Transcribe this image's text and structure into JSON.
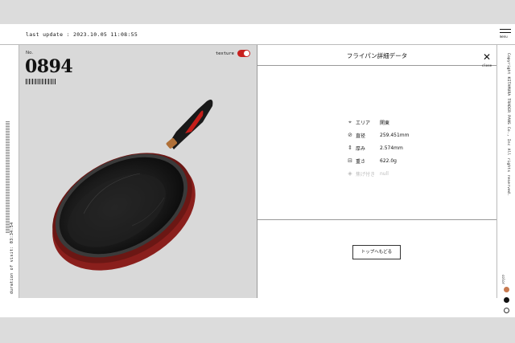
{
  "header": {
    "last_update": "last update : 2023.10.05 11:08:55",
    "menu_label": "menu"
  },
  "left_rail": {
    "duration": "duration of visit: 03:34:54"
  },
  "product": {
    "no_label": "No.",
    "number": "0894",
    "texture_label": "texture",
    "texture_on": true
  },
  "detail": {
    "title": "フライパン詳細データ",
    "close_label": "close",
    "specs": [
      {
        "icon": "location-pin-icon",
        "label": "エリア",
        "value": "関東"
      },
      {
        "icon": "diameter-icon",
        "label": "直径",
        "value": "259.451mm"
      },
      {
        "icon": "thickness-icon",
        "label": "厚み",
        "value": "2.574mm"
      },
      {
        "icon": "weight-icon",
        "label": "重さ",
        "value": "622.0g"
      },
      {
        "icon": "burn-icon",
        "label": "焦げ付き",
        "value": "null"
      }
    ],
    "back_button": "トップへもどる"
  },
  "right_rail": {
    "copyright": "Copyright KITAMURA TRADER PANS Co., Inc All rights reserved.",
    "color_label": "color",
    "colors": [
      "#c87a50",
      "#111111",
      "#ffffff"
    ]
  }
}
